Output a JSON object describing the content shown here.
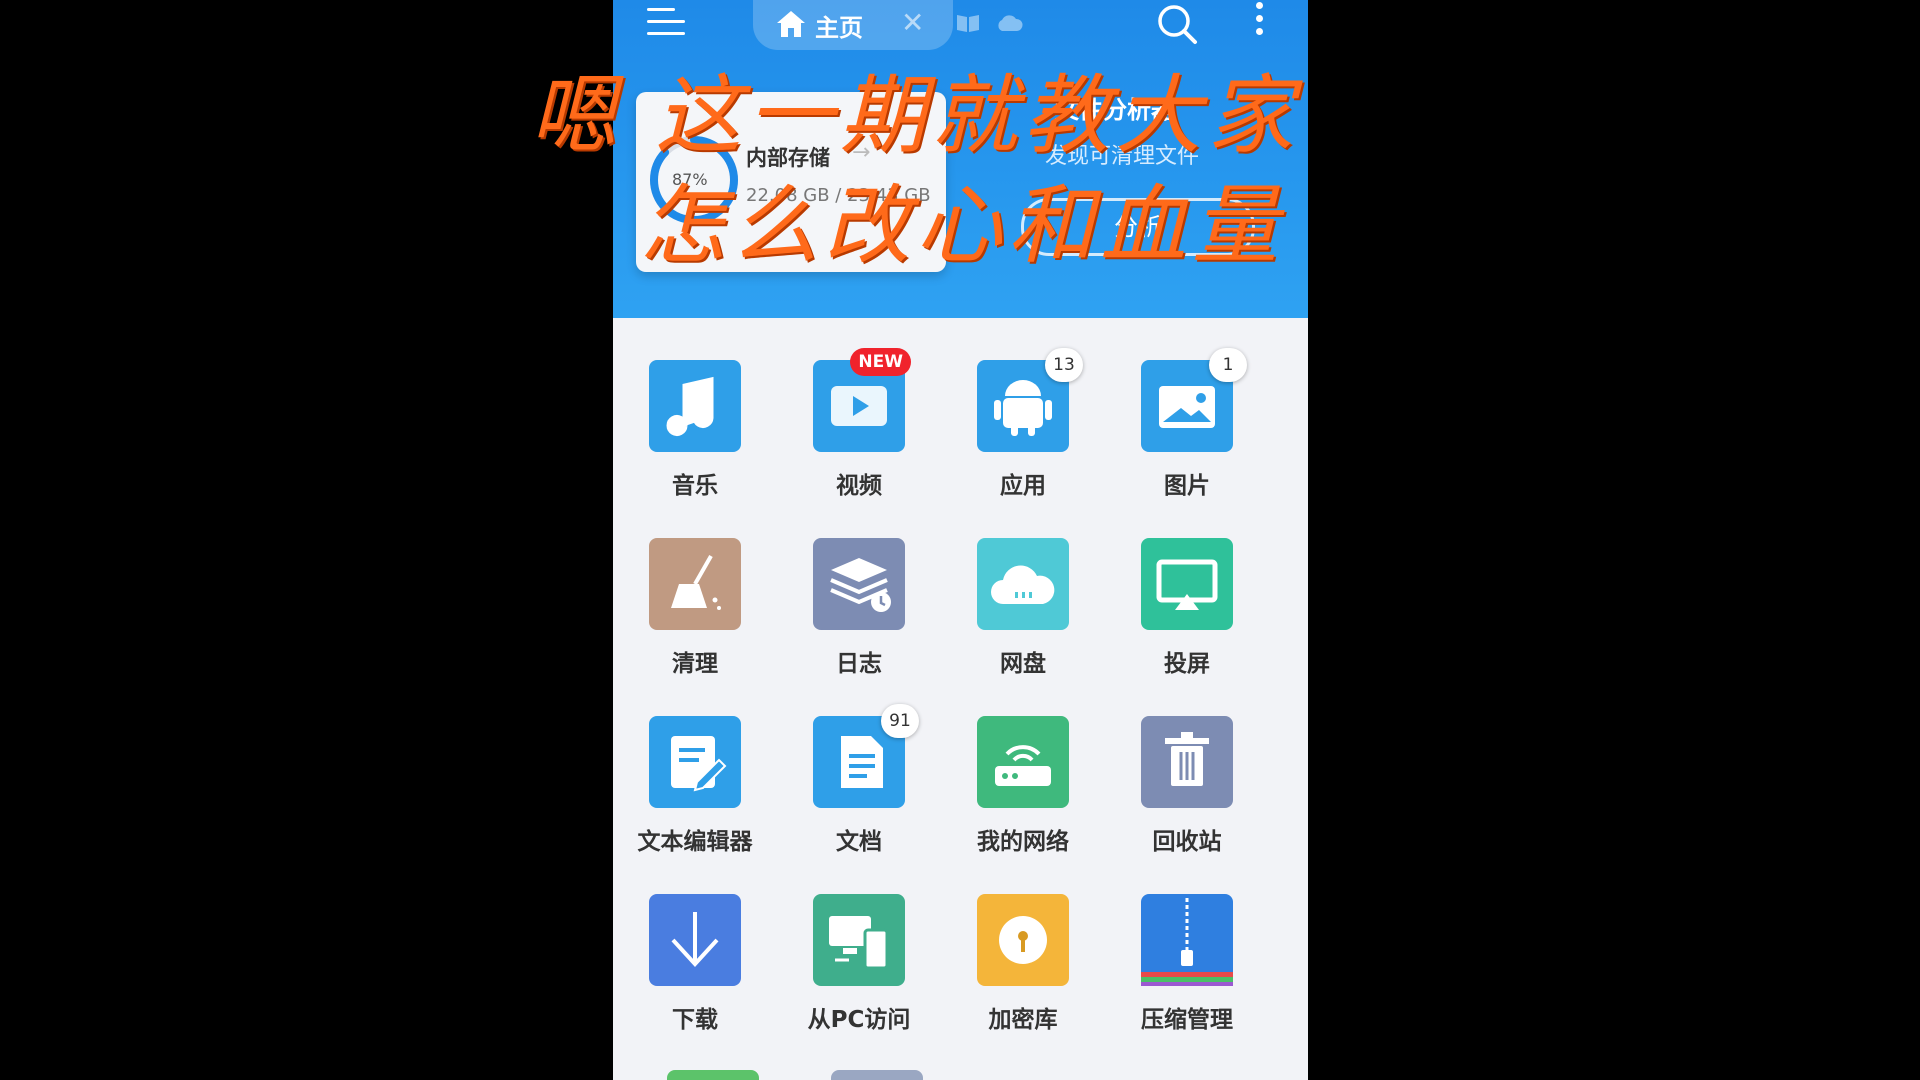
{
  "topbar": {
    "home_tab_label": "主页",
    "close_glyph": "✕"
  },
  "storage": {
    "percent": "87%",
    "percent_value": 87,
    "title": "内部存储",
    "used": "22.08 GB / 23.43 GB"
  },
  "analyzer": {
    "title": "文件分析器",
    "subtitle": "发现可清理文件",
    "button": "分析"
  },
  "overlay": {
    "line1": "嗯 这一期就教大家",
    "line2": "怎么改心和血量"
  },
  "colors": {
    "header": "#2393ec",
    "overlay_text": "#ff6a1a"
  },
  "grid": [
    {
      "label": "音乐",
      "icon": "music-note-icon",
      "color": "#2f9fe8"
    },
    {
      "label": "视频",
      "icon": "video-play-icon",
      "color": "#2f9fe8",
      "badge": "NEW"
    },
    {
      "label": "应用",
      "icon": "android-icon",
      "color": "#2f9fe8",
      "badge": "13"
    },
    {
      "label": "图片",
      "icon": "image-icon",
      "color": "#2f9fe8",
      "badge": "1"
    },
    {
      "label": "清理",
      "icon": "broom-icon",
      "color": "#c09a82"
    },
    {
      "label": "日志",
      "icon": "log-stack-icon",
      "color": "#7d8cb3"
    },
    {
      "label": "网盘",
      "icon": "cloud-icon",
      "color": "#4fc9d6"
    },
    {
      "label": "投屏",
      "icon": "screen-cast-icon",
      "color": "#2fc19a"
    },
    {
      "label": "文本编辑器",
      "icon": "text-edit-icon",
      "color": "#2f9fe8"
    },
    {
      "label": "文档",
      "icon": "document-icon",
      "color": "#2f9fe8",
      "badge": "91"
    },
    {
      "label": "我的网络",
      "icon": "router-icon",
      "color": "#3fb97d"
    },
    {
      "label": "回收站",
      "icon": "trash-icon",
      "color": "#7d8cb3"
    },
    {
      "label": "下载",
      "icon": "download-icon",
      "color": "#4a7de0"
    },
    {
      "label": "从PC访问",
      "icon": "pc-phone-icon",
      "color": "#3fae8c"
    },
    {
      "label": "加密库",
      "icon": "lock-icon",
      "color": "#f4b53a"
    },
    {
      "label": "压缩管理",
      "icon": "zip-icon",
      "color": "#2f7fe0"
    }
  ]
}
